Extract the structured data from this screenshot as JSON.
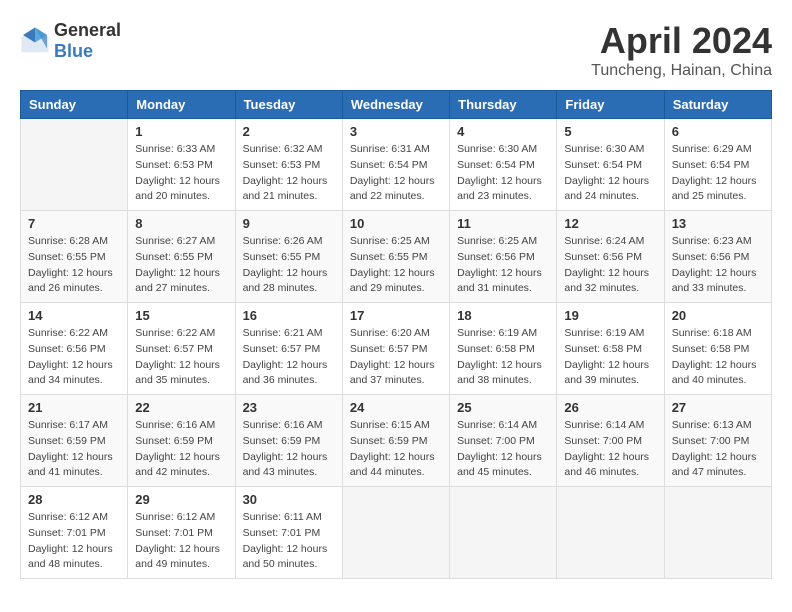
{
  "header": {
    "logo_general": "General",
    "logo_blue": "Blue",
    "month_year": "April 2024",
    "location": "Tuncheng, Hainan, China"
  },
  "days_of_week": [
    "Sunday",
    "Monday",
    "Tuesday",
    "Wednesday",
    "Thursday",
    "Friday",
    "Saturday"
  ],
  "weeks": [
    [
      {
        "day": "",
        "sunrise": "",
        "sunset": "",
        "daylight": ""
      },
      {
        "day": "1",
        "sunrise": "Sunrise: 6:33 AM",
        "sunset": "Sunset: 6:53 PM",
        "daylight": "Daylight: 12 hours and 20 minutes."
      },
      {
        "day": "2",
        "sunrise": "Sunrise: 6:32 AM",
        "sunset": "Sunset: 6:53 PM",
        "daylight": "Daylight: 12 hours and 21 minutes."
      },
      {
        "day": "3",
        "sunrise": "Sunrise: 6:31 AM",
        "sunset": "Sunset: 6:54 PM",
        "daylight": "Daylight: 12 hours and 22 minutes."
      },
      {
        "day": "4",
        "sunrise": "Sunrise: 6:30 AM",
        "sunset": "Sunset: 6:54 PM",
        "daylight": "Daylight: 12 hours and 23 minutes."
      },
      {
        "day": "5",
        "sunrise": "Sunrise: 6:30 AM",
        "sunset": "Sunset: 6:54 PM",
        "daylight": "Daylight: 12 hours and 24 minutes."
      },
      {
        "day": "6",
        "sunrise": "Sunrise: 6:29 AM",
        "sunset": "Sunset: 6:54 PM",
        "daylight": "Daylight: 12 hours and 25 minutes."
      }
    ],
    [
      {
        "day": "7",
        "sunrise": "Sunrise: 6:28 AM",
        "sunset": "Sunset: 6:55 PM",
        "daylight": "Daylight: 12 hours and 26 minutes."
      },
      {
        "day": "8",
        "sunrise": "Sunrise: 6:27 AM",
        "sunset": "Sunset: 6:55 PM",
        "daylight": "Daylight: 12 hours and 27 minutes."
      },
      {
        "day": "9",
        "sunrise": "Sunrise: 6:26 AM",
        "sunset": "Sunset: 6:55 PM",
        "daylight": "Daylight: 12 hours and 28 minutes."
      },
      {
        "day": "10",
        "sunrise": "Sunrise: 6:25 AM",
        "sunset": "Sunset: 6:55 PM",
        "daylight": "Daylight: 12 hours and 29 minutes."
      },
      {
        "day": "11",
        "sunrise": "Sunrise: 6:25 AM",
        "sunset": "Sunset: 6:56 PM",
        "daylight": "Daylight: 12 hours and 31 minutes."
      },
      {
        "day": "12",
        "sunrise": "Sunrise: 6:24 AM",
        "sunset": "Sunset: 6:56 PM",
        "daylight": "Daylight: 12 hours and 32 minutes."
      },
      {
        "day": "13",
        "sunrise": "Sunrise: 6:23 AM",
        "sunset": "Sunset: 6:56 PM",
        "daylight": "Daylight: 12 hours and 33 minutes."
      }
    ],
    [
      {
        "day": "14",
        "sunrise": "Sunrise: 6:22 AM",
        "sunset": "Sunset: 6:56 PM",
        "daylight": "Daylight: 12 hours and 34 minutes."
      },
      {
        "day": "15",
        "sunrise": "Sunrise: 6:22 AM",
        "sunset": "Sunset: 6:57 PM",
        "daylight": "Daylight: 12 hours and 35 minutes."
      },
      {
        "day": "16",
        "sunrise": "Sunrise: 6:21 AM",
        "sunset": "Sunset: 6:57 PM",
        "daylight": "Daylight: 12 hours and 36 minutes."
      },
      {
        "day": "17",
        "sunrise": "Sunrise: 6:20 AM",
        "sunset": "Sunset: 6:57 PM",
        "daylight": "Daylight: 12 hours and 37 minutes."
      },
      {
        "day": "18",
        "sunrise": "Sunrise: 6:19 AM",
        "sunset": "Sunset: 6:58 PM",
        "daylight": "Daylight: 12 hours and 38 minutes."
      },
      {
        "day": "19",
        "sunrise": "Sunrise: 6:19 AM",
        "sunset": "Sunset: 6:58 PM",
        "daylight": "Daylight: 12 hours and 39 minutes."
      },
      {
        "day": "20",
        "sunrise": "Sunrise: 6:18 AM",
        "sunset": "Sunset: 6:58 PM",
        "daylight": "Daylight: 12 hours and 40 minutes."
      }
    ],
    [
      {
        "day": "21",
        "sunrise": "Sunrise: 6:17 AM",
        "sunset": "Sunset: 6:59 PM",
        "daylight": "Daylight: 12 hours and 41 minutes."
      },
      {
        "day": "22",
        "sunrise": "Sunrise: 6:16 AM",
        "sunset": "Sunset: 6:59 PM",
        "daylight": "Daylight: 12 hours and 42 minutes."
      },
      {
        "day": "23",
        "sunrise": "Sunrise: 6:16 AM",
        "sunset": "Sunset: 6:59 PM",
        "daylight": "Daylight: 12 hours and 43 minutes."
      },
      {
        "day": "24",
        "sunrise": "Sunrise: 6:15 AM",
        "sunset": "Sunset: 6:59 PM",
        "daylight": "Daylight: 12 hours and 44 minutes."
      },
      {
        "day": "25",
        "sunrise": "Sunrise: 6:14 AM",
        "sunset": "Sunset: 7:00 PM",
        "daylight": "Daylight: 12 hours and 45 minutes."
      },
      {
        "day": "26",
        "sunrise": "Sunrise: 6:14 AM",
        "sunset": "Sunset: 7:00 PM",
        "daylight": "Daylight: 12 hours and 46 minutes."
      },
      {
        "day": "27",
        "sunrise": "Sunrise: 6:13 AM",
        "sunset": "Sunset: 7:00 PM",
        "daylight": "Daylight: 12 hours and 47 minutes."
      }
    ],
    [
      {
        "day": "28",
        "sunrise": "Sunrise: 6:12 AM",
        "sunset": "Sunset: 7:01 PM",
        "daylight": "Daylight: 12 hours and 48 minutes."
      },
      {
        "day": "29",
        "sunrise": "Sunrise: 6:12 AM",
        "sunset": "Sunset: 7:01 PM",
        "daylight": "Daylight: 12 hours and 49 minutes."
      },
      {
        "day": "30",
        "sunrise": "Sunrise: 6:11 AM",
        "sunset": "Sunset: 7:01 PM",
        "daylight": "Daylight: 12 hours and 50 minutes."
      },
      {
        "day": "",
        "sunrise": "",
        "sunset": "",
        "daylight": ""
      },
      {
        "day": "",
        "sunrise": "",
        "sunset": "",
        "daylight": ""
      },
      {
        "day": "",
        "sunrise": "",
        "sunset": "",
        "daylight": ""
      },
      {
        "day": "",
        "sunrise": "",
        "sunset": "",
        "daylight": ""
      }
    ]
  ]
}
